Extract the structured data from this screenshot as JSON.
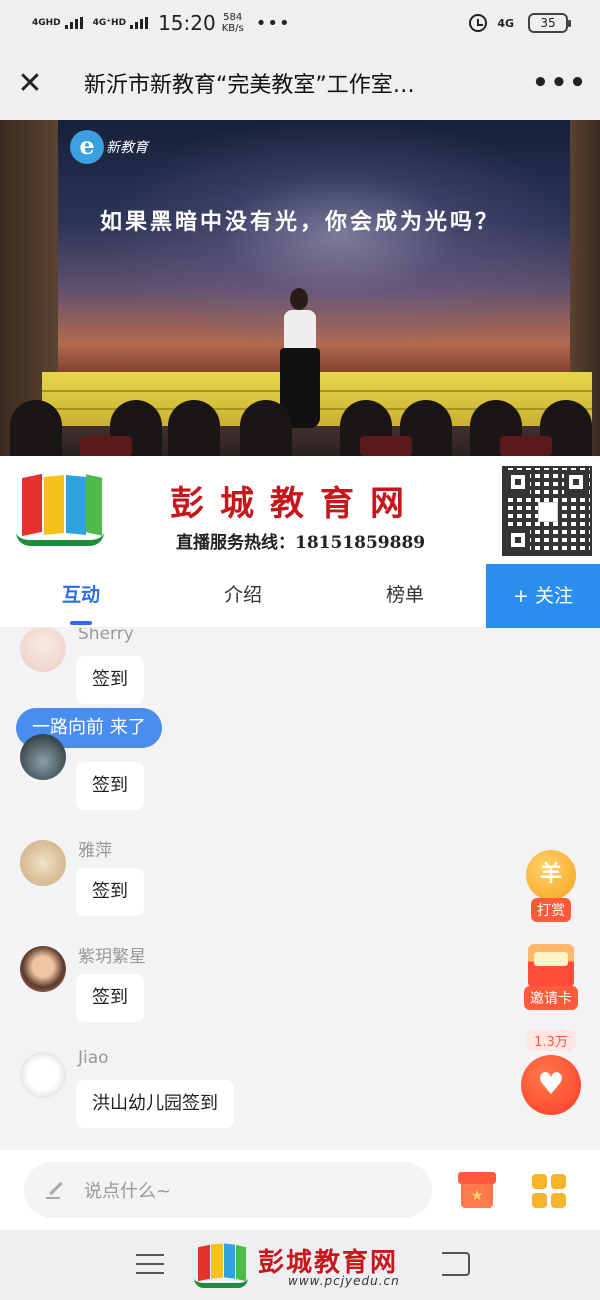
{
  "status_bar": {
    "net1": "4GHD",
    "net2": "4G⁺HD",
    "time": "15:20",
    "speed_value": "584",
    "speed_unit": "KB/s",
    "dots": "•••",
    "net3": "4G",
    "battery": "35"
  },
  "title_bar": {
    "close_glyph": "✕",
    "title": "新沂市新教育“完美教室”工作室…",
    "more_glyph": "•••"
  },
  "video": {
    "logo_letter": "e",
    "logo_text": "新教育",
    "caption": "如果黑暗中没有光，你会成为光吗？"
  },
  "banner": {
    "name": "彭城教育网",
    "hotline": "直播服务热线：18151859889"
  },
  "tabs": [
    {
      "label": "互动"
    },
    {
      "label": "介绍"
    },
    {
      "label": "榜单"
    }
  ],
  "follow_label": "+ 关注",
  "chat": {
    "join_notice": "一路向前 来了",
    "messages": [
      {
        "user": "Sherry",
        "text": "签到"
      },
      {
        "user": "",
        "text": "签到"
      },
      {
        "user": "雅萍",
        "text": "签到"
      },
      {
        "user": "紫玥繁星",
        "text": "签到"
      },
      {
        "user": "Jiao",
        "text": "洪山幼儿园签到"
      }
    ]
  },
  "floating": {
    "reward_glyph": "羊",
    "reward_label": "打赏",
    "invite_label": "邀请卡",
    "like_count": "1.3万",
    "like_glyph": "♥"
  },
  "input": {
    "placeholder": "说点什么~"
  },
  "watermark": {
    "name": "彭城教育网",
    "url": "www.pcjyedu.cn"
  },
  "colors": {
    "accent": "#2c6cf0",
    "follow_bg": "#2a8ef0",
    "brand_red": "#c8161d",
    "join_pill": "#4a8df0"
  }
}
